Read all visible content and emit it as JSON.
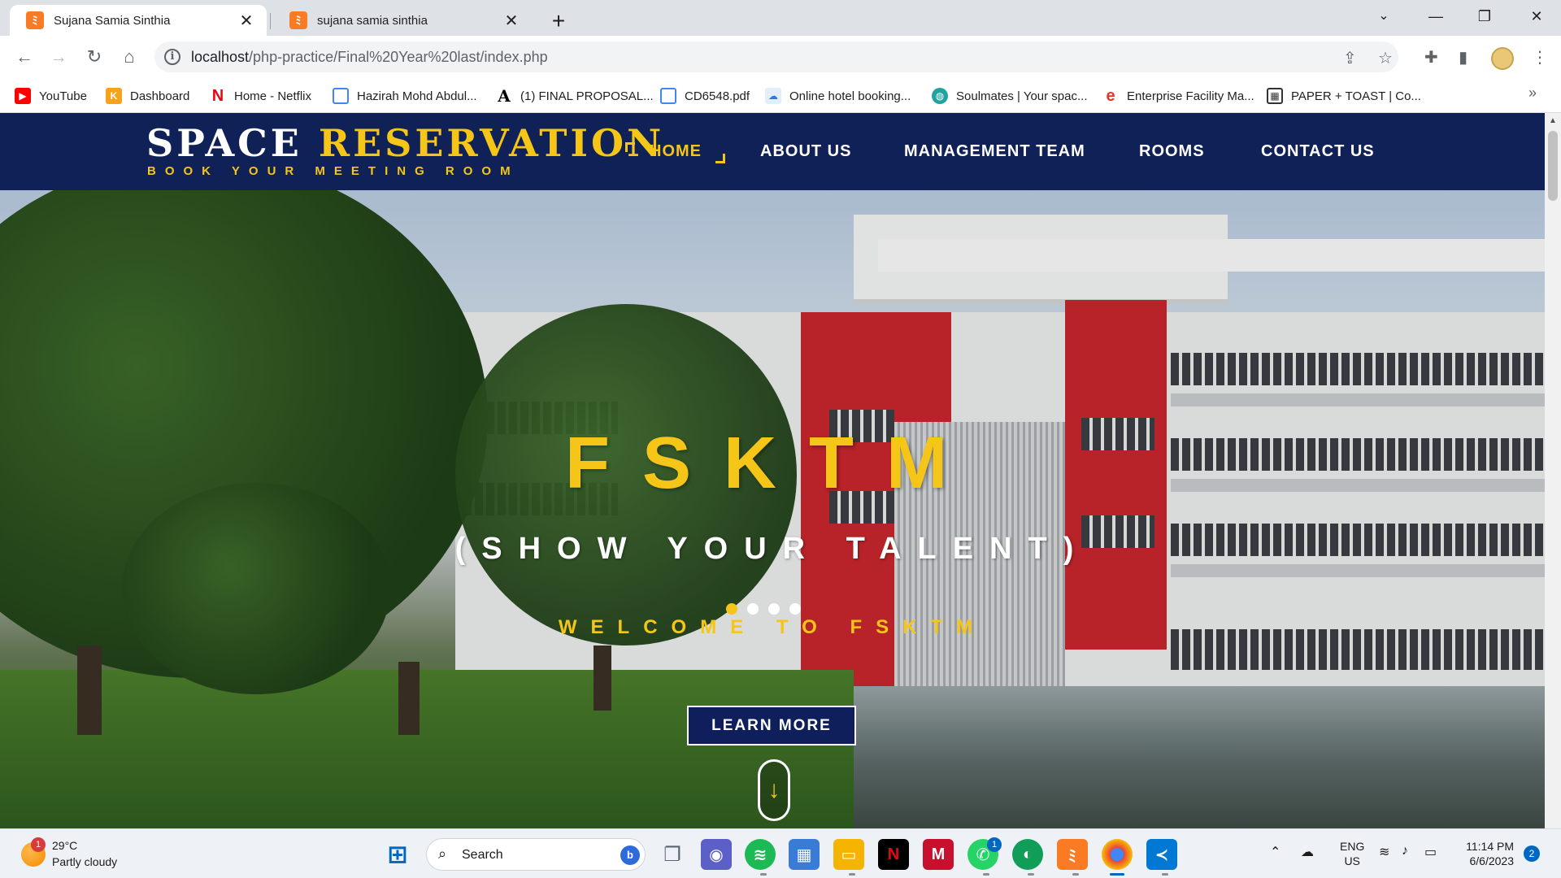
{
  "browser": {
    "tabs": [
      {
        "title": "Sujana Samia Sinthia",
        "favicon": "xampp-icon",
        "active": true
      },
      {
        "title": "sujana samia sinthia",
        "favicon": "xampp-icon",
        "active": false
      }
    ],
    "new_tab": "+",
    "url_host": "localhost",
    "url_path": "/php-practice/Final%20Year%20last/index.php",
    "bookmarks": [
      {
        "label": "YouTube",
        "icon": "youtube-icon",
        "color": "#ff0000"
      },
      {
        "label": "Dashboard",
        "icon": "k-icon",
        "color": "#f7a21b"
      },
      {
        "label": "Home - Netflix",
        "icon": "netflix-icon",
        "color": "#e50914"
      },
      {
        "label": "Hazirah Mohd Abdul...",
        "icon": "doc-icon",
        "color": "#4285f4"
      },
      {
        "label": "(1) FINAL PROPOSAL...",
        "icon": "a-icon",
        "color": "#000000"
      },
      {
        "label": "CD6548.pdf",
        "icon": "doc-icon",
        "color": "#4285f4"
      },
      {
        "label": "Online hotel booking...",
        "icon": "cloud-icon",
        "color": "#2e7bd6"
      },
      {
        "label": "Soulmates | Your spac...",
        "icon": "globe-icon",
        "color": "#22a39f"
      },
      {
        "label": "Enterprise Facility Ma...",
        "icon": "edge-icon",
        "color": "#e8342b"
      },
      {
        "label": "PAPER + TOAST | Co...",
        "icon": "grid-icon",
        "color": "#333333"
      }
    ],
    "bookmarks_more": "»"
  },
  "site": {
    "brand_white": "SPACE ",
    "brand_yellow": "RESERVATION",
    "tagline": "BOOK YOUR MEETING ROOM",
    "nav": [
      "HOME",
      "ABOUT US",
      "MANAGEMENT TEAM",
      "ROOMS",
      "CONTACT US"
    ],
    "nav_active": "HOME",
    "hero": {
      "title": "FSKTM",
      "subtitle": "(SHOW YOUR TALENT)",
      "welcome": "WELCOME TO FSKTM",
      "button": "LEARN MORE",
      "scroll_icon": "↓",
      "slides_count": 4,
      "active_slide": 0
    },
    "colors": {
      "navy": "#102157",
      "accent": "#f5c518"
    }
  },
  "taskbar": {
    "weather_temp": "29°C",
    "weather_cond": "Partly cloudy",
    "weather_badge": "1",
    "search_label": "Search",
    "whatsapp_badge": "1",
    "lang_top": "ENG",
    "lang_bottom": "US",
    "time": "11:14 PM",
    "date": "6/6/2023",
    "notifications": "2"
  }
}
